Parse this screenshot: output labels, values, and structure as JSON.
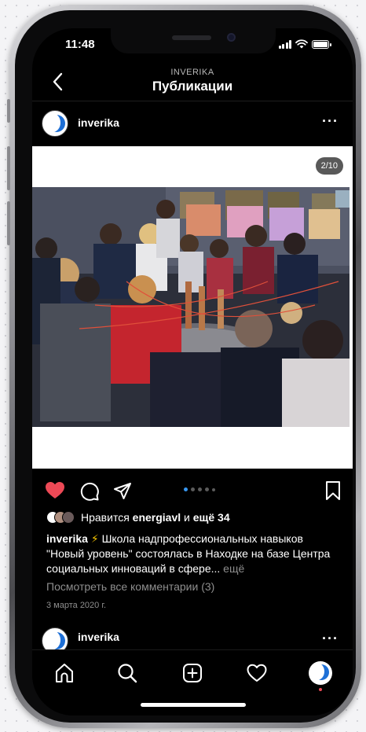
{
  "status_bar": {
    "time": "11:48"
  },
  "header": {
    "subtitle": "INVERIKA",
    "title": "Публикации"
  },
  "post": {
    "username": "inverika",
    "more_label": "···",
    "image_counter": "2/10",
    "likes": {
      "prefix": "Нравится",
      "user": "energiavl",
      "middle": "и",
      "others": "ещё 34"
    },
    "caption": {
      "username": "inverika",
      "emoji": "⚡",
      "text": "Школа надпрофессиональных навыков \"Новый уровень\" состоялась в Находке на базе Центра социальных инноваций в сфере...",
      "more": "ещё"
    },
    "comments_link": "Посмотреть все комментарии (3)",
    "date": "3 марта 2020 г.",
    "liked": true,
    "carousel": {
      "dots": 5,
      "active_index": 1
    }
  },
  "next_post": {
    "username": "inverika",
    "more_label": "···"
  },
  "tabs": [
    "home",
    "search",
    "create",
    "activity",
    "profile"
  ],
  "colors": {
    "like_red": "#ed4956",
    "accent_blue": "#3897f0",
    "background": "#000000",
    "muted_text": "#8e8e8e"
  }
}
